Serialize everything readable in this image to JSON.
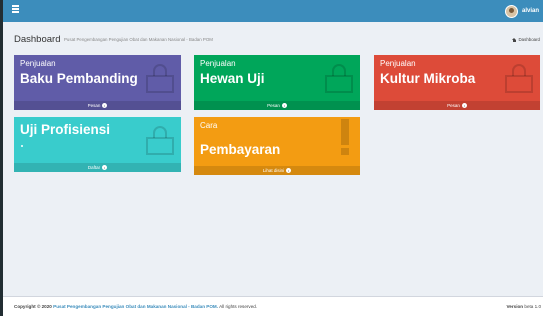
{
  "user": {
    "name": "alvian"
  },
  "header": {
    "title": "Dashboard",
    "subtitle": "Pusat Pengembangan Pengujian Obat dan Makanan Nasional - Badan POM",
    "breadcrumb": "Dashboard"
  },
  "tiles": [
    {
      "small": "Penjualan",
      "big": "Baku Pembanding",
      "footer": "Pesan",
      "color": "#605ca8",
      "icon": "shopping-bag-icon"
    },
    {
      "small": "Penjualan",
      "big": "Hewan Uji",
      "footer": "Pesan",
      "color": "#00a65a",
      "icon": "shopping-bag-icon"
    },
    {
      "small": "Penjualan",
      "big": "Kultur Mikroba",
      "footer": "Pesan",
      "color": "#dd4b39",
      "icon": "shopping-bag-icon"
    },
    {
      "small": "",
      "big": "Uji Profisiensi",
      "footer": "Daftar",
      "color": "#39cccc",
      "icon": "shopping-bag-icon"
    },
    {
      "small": "Cara",
      "big": "Pembayaran",
      "footer": "Lihat disini",
      "color": "#f39c12",
      "icon": "exclamation-icon"
    }
  ],
  "footer": {
    "copyright_prefix": "Copyright © 2020",
    "organization": "Pusat Pengembangan Pengujian Obat dan Makanan Nasional - Badan POM.",
    "rights": "All rights reserved.",
    "version_label": "Version",
    "version_value": "beta 1.0"
  }
}
